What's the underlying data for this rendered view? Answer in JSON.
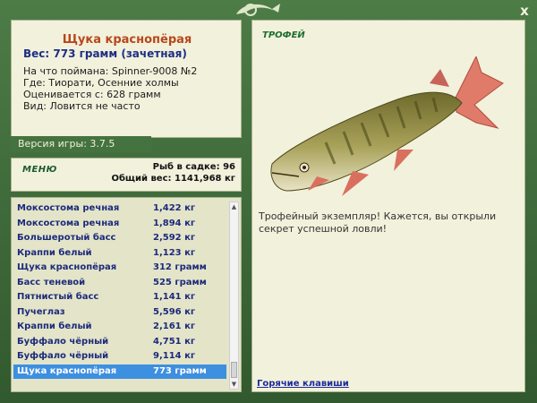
{
  "window": {
    "close_label": "x"
  },
  "fish_info": {
    "name": "Щука краснопёрая",
    "weight": "Вес: 773 грамм (зачетная)",
    "caught_on": "На что поймана: Spinner-9008 №2",
    "location": "Где: Тиорати, Осенние холмы",
    "valued_from": "Оценивается с: 628 грамм",
    "rarity": "Вид: Ловится не часто"
  },
  "version": "Версия игры: 3.7.5",
  "menu_label": "МЕНЮ",
  "keepnet": {
    "count": "Рыб в садке: 96",
    "total_weight": "Общий вес: 1141,968 кг"
  },
  "catch_list": [
    {
      "name": "Моксостома речная",
      "weight": "1,422 кг"
    },
    {
      "name": "Моксостома речная",
      "weight": "1,894 кг"
    },
    {
      "name": "Большеротый басс",
      "weight": "2,592 кг"
    },
    {
      "name": "Краппи белый",
      "weight": "1,123 кг"
    },
    {
      "name": "Щука краснопёрая",
      "weight": "312 грамм"
    },
    {
      "name": "Басс теневой",
      "weight": "525 грамм"
    },
    {
      "name": "Пятнистый басс",
      "weight": "1,141 кг"
    },
    {
      "name": "Пучеглаз",
      "weight": "5,596 кг"
    },
    {
      "name": "Краппи белый",
      "weight": "2,161 кг"
    },
    {
      "name": "Буффало чёрный",
      "weight": "4,751 кг"
    },
    {
      "name": "Буффало чёрный",
      "weight": "9,114 кг"
    },
    {
      "name": "Щука краснопёрая",
      "weight": "773 грамм"
    }
  ],
  "selected_index": 11,
  "trophy_label": "ТРОФЕЙ",
  "trophy_text": "Трофейный экземпляр! Кажется, вы открыли секрет успешной ловли!",
  "hotkeys_label": "Горячие клавиши",
  "colors": {
    "frame": "#3f6b3c",
    "panel": "#f2f1dc",
    "selected": "#3d8fe0",
    "title": "#b7471c"
  }
}
